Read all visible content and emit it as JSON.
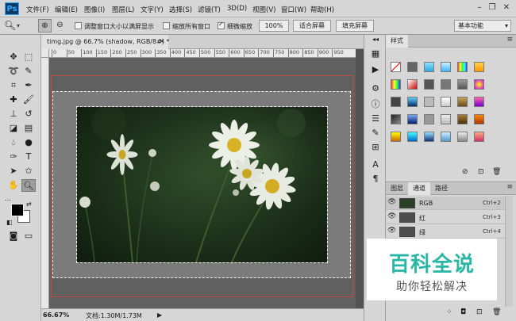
{
  "app": {
    "logo": "Ps"
  },
  "menubar": {
    "items": [
      "文件(F)",
      "编辑(E)",
      "图像(I)",
      "图层(L)",
      "文字(Y)",
      "选择(S)",
      "滤镜(T)",
      "3D(D)",
      "视图(V)",
      "窗口(W)",
      "帮助(H)"
    ]
  },
  "options": {
    "resize_windows_label": "调整窗口大小以满屏显示",
    "resize_windows_checked": false,
    "zoom_all_label": "缩放所有窗口",
    "zoom_all_checked": false,
    "scrubby_zoom_label": "细微缩放",
    "scrubby_zoom_checked": true,
    "btn_100": "100%",
    "btn_fit": "适合屏幕",
    "btn_fill": "填充屏幕",
    "workspace": "基本功能"
  },
  "document": {
    "tab_title": "timg.jpg @ 66.7% (shadow, RGB/8#) *",
    "zoom_status": "66.67%",
    "doc_size": "文档:1.30M/1.73M"
  },
  "ruler": {
    "ticks": [
      "0",
      "50",
      "100",
      "150",
      "200",
      "250",
      "300",
      "350",
      "400",
      "450",
      "500",
      "550",
      "600",
      "650",
      "700",
      "750",
      "800",
      "850",
      "900",
      "950"
    ]
  },
  "styles_panel": {
    "tab": "样式"
  },
  "channels_panel": {
    "tabs": [
      "图层",
      "通道",
      "路径"
    ],
    "active_tab": 1,
    "channels": [
      {
        "name": "RGB",
        "shortcut": "Ctrl+2"
      },
      {
        "name": "红",
        "shortcut": "Ctrl+3"
      },
      {
        "name": "绿",
        "shortcut": "Ctrl+4"
      }
    ]
  },
  "watermark": {
    "title": "百科全说",
    "subtitle": "助你轻松解决"
  },
  "colors": {
    "ui_gray": "#d6d6d6",
    "canvas_gray": "#606060",
    "guide_red": "#c04a4a",
    "watermark_green": "#27b7a4",
    "ps_blue": "#31a8ff"
  }
}
